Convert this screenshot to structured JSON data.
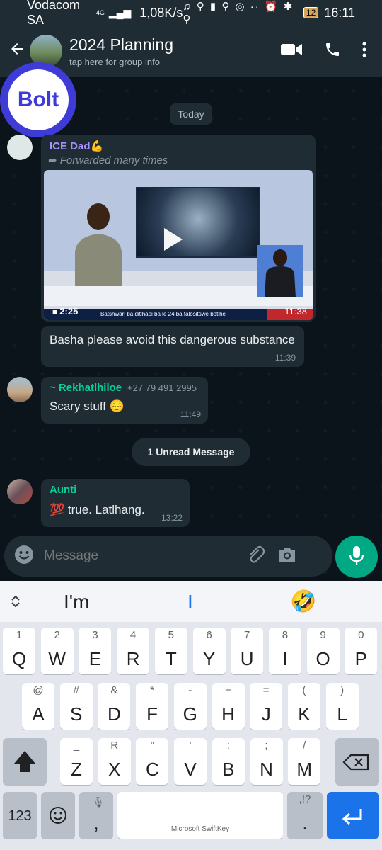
{
  "status_bar": {
    "carrier": "Vodacom SA",
    "network": "4G",
    "speed": "1,08K/s",
    "icons": "♫ ⚲ ▮ ⚲ ◎ ·· ⏰ ✱ ⚲",
    "battery": "12",
    "time": "16:11"
  },
  "header": {
    "title": "2024 Planning",
    "subtitle": "tap here for group info"
  },
  "overlay_logo": "Bolt",
  "chat": {
    "date_chip": "Today",
    "unread_chip": "1 Unread Message",
    "messages": [
      {
        "sender": "ICE Dad💪",
        "forwarded": "Forwarded many times",
        "video_duration": "2:25",
        "video_time": "11:38",
        "ticker": "Batshwari ba ditlhapi ba le 24 ba falositswe botlhe",
        "text": "Basha please avoid this dangerous substance",
        "time": "11:39",
        "sender_color": "#a791ff"
      },
      {
        "sender": "~ Rekhatlhiloe",
        "phone": "+27 79 491 2995",
        "text": "Scary stuff 😔",
        "time": "11:49",
        "sender_color": "#06cf9c"
      },
      {
        "sender": "Aunti",
        "text": "💯 true. Latlhang.",
        "time": "13:22",
        "sender_color": "#06cf9c"
      }
    ]
  },
  "composer": {
    "placeholder": "Message"
  },
  "keyboard": {
    "suggestion_left": "I'm",
    "suggestion_mid": "I",
    "suggestion_emoji": "🤣",
    "row1": [
      {
        "main": "Q",
        "hint": "1"
      },
      {
        "main": "W",
        "hint": "2"
      },
      {
        "main": "E",
        "hint": "3"
      },
      {
        "main": "R",
        "hint": "4"
      },
      {
        "main": "T",
        "hint": "5"
      },
      {
        "main": "Y",
        "hint": "6"
      },
      {
        "main": "U",
        "hint": "7"
      },
      {
        "main": "I",
        "hint": "8"
      },
      {
        "main": "O",
        "hint": "9"
      },
      {
        "main": "P",
        "hint": "0"
      }
    ],
    "row2": [
      {
        "main": "A",
        "hint": "@"
      },
      {
        "main": "S",
        "hint": "#"
      },
      {
        "main": "D",
        "hint": "&"
      },
      {
        "main": "F",
        "hint": "*"
      },
      {
        "main": "G",
        "hint": "-"
      },
      {
        "main": "H",
        "hint": "+"
      },
      {
        "main": "J",
        "hint": "="
      },
      {
        "main": "K",
        "hint": "("
      },
      {
        "main": "L",
        "hint": ")"
      }
    ],
    "row3": [
      {
        "main": "Z",
        "hint": "_"
      },
      {
        "main": "X",
        "hint": "R"
      },
      {
        "main": "C",
        "hint": "\""
      },
      {
        "main": "V",
        "hint": "'"
      },
      {
        "main": "B",
        "hint": ":"
      },
      {
        "main": "N",
        "hint": ";"
      },
      {
        "main": "M",
        "hint": "/"
      }
    ],
    "key_123": "123",
    "comma": ",",
    "period": ".",
    "period_hint": ",!?",
    "space_label": "Microsoft SwiftKey"
  },
  "colors": {
    "accent_green": "#00a884",
    "bubble": "#202c33",
    "header": "#1f2c34"
  }
}
